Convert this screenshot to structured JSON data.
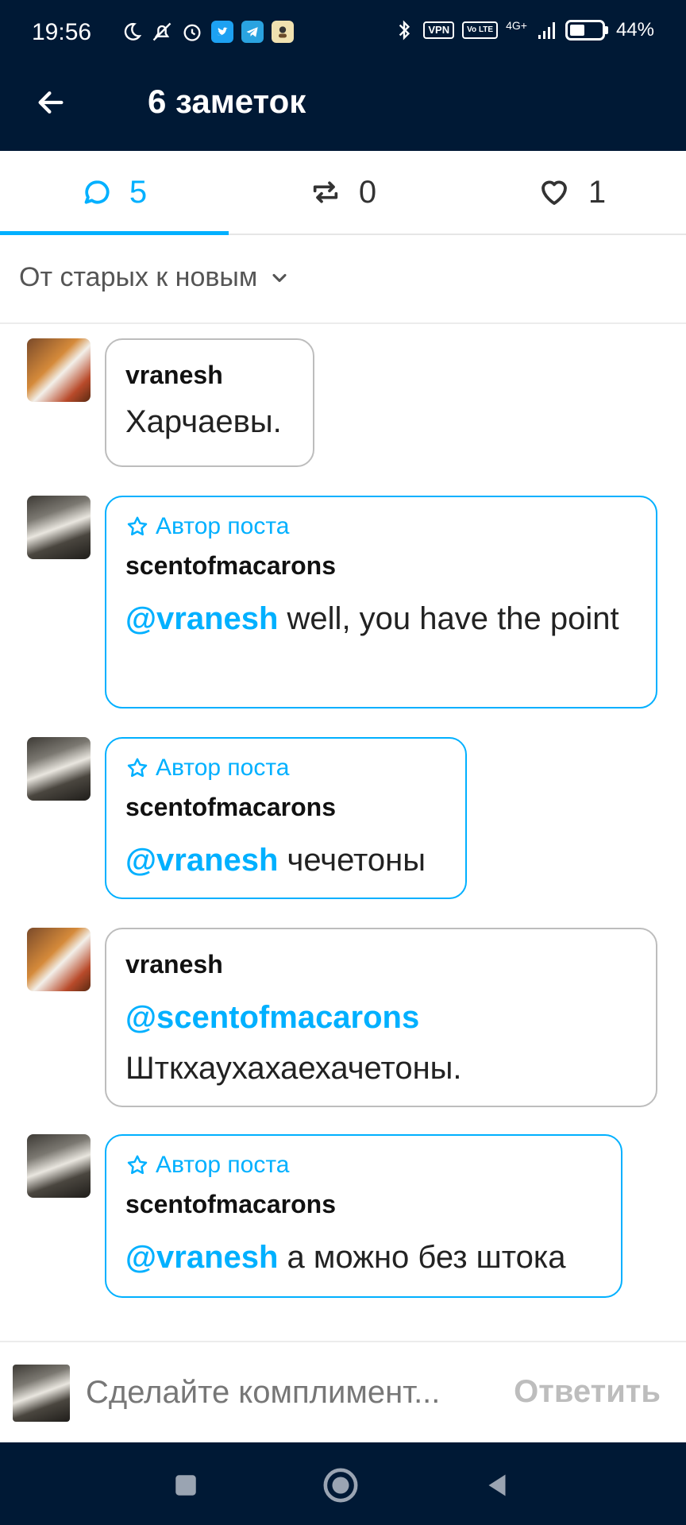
{
  "status_bar": {
    "time": "19:56",
    "vpn": "VPN",
    "volte": "Vo LTE",
    "network": "4G+",
    "battery": "44%"
  },
  "header": {
    "title": "6 заметок"
  },
  "tabs": [
    {
      "icon": "comment-icon",
      "count": "5",
      "active": true
    },
    {
      "icon": "reblog-icon",
      "count": "0",
      "active": false
    },
    {
      "icon": "heart-icon",
      "count": "1",
      "active": false
    }
  ],
  "sort": {
    "label": "От старых к новым"
  },
  "notes": [
    {
      "username": "vranesh",
      "author_badge": "",
      "mention": "",
      "text": "Харчаевы."
    },
    {
      "username": "scentofmacarons",
      "author_badge": "Автор поста",
      "mention": "@vranesh",
      "text": " well, you have the point"
    },
    {
      "username": "scentofmacarons",
      "author_badge": "Автор поста",
      "mention": "@vranesh",
      "text": " чечетоны"
    },
    {
      "username": "vranesh",
      "author_badge": "",
      "mention": "@scentofmacarons",
      "text": "Шткхаухахаехачетоны."
    },
    {
      "username": "scentofmacarons",
      "author_badge": "Автор поста",
      "mention": "@vranesh",
      "text": " а можно без штока"
    }
  ],
  "reply": {
    "placeholder": "Сделайте комплимент...",
    "button": "Ответить"
  },
  "colors": {
    "header_bg": "#001935",
    "accent": "#00b0ff"
  }
}
